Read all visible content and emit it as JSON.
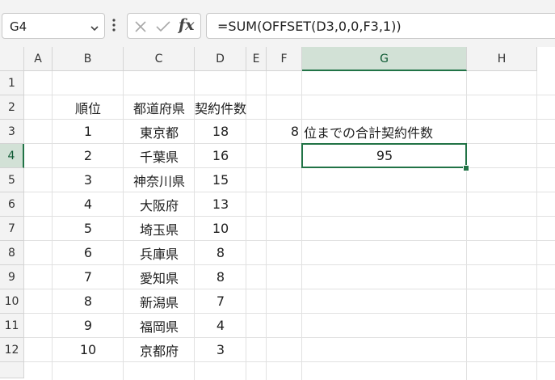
{
  "formula_bar": {
    "name_box": "G4",
    "formula": "=SUM(OFFSET(D3,0,0,F3,1))"
  },
  "columns": [
    "A",
    "B",
    "C",
    "D",
    "E",
    "F",
    "G",
    "H"
  ],
  "rows": [
    "1",
    "2",
    "3",
    "4",
    "5",
    "6",
    "7",
    "8",
    "9",
    "10",
    "11",
    "12"
  ],
  "selection": {
    "column": "G",
    "row": "4"
  },
  "table": {
    "headers": {
      "rank": "順位",
      "prefecture": "都道府県",
      "contracts": "契約件数"
    },
    "records": [
      {
        "rank": "1",
        "prefecture": "東京都",
        "contracts": "18"
      },
      {
        "rank": "2",
        "prefecture": "千葉県",
        "contracts": "16"
      },
      {
        "rank": "3",
        "prefecture": "神奈川県",
        "contracts": "15"
      },
      {
        "rank": "4",
        "prefecture": "大阪府",
        "contracts": "13"
      },
      {
        "rank": "5",
        "prefecture": "埼玉県",
        "contracts": "10"
      },
      {
        "rank": "6",
        "prefecture": "兵庫県",
        "contracts": "8"
      },
      {
        "rank": "7",
        "prefecture": "愛知県",
        "contracts": "8"
      },
      {
        "rank": "8",
        "prefecture": "新潟県",
        "contracts": "7"
      },
      {
        "rank": "9",
        "prefecture": "福岡県",
        "contracts": "4"
      },
      {
        "rank": "10",
        "prefecture": "京都府",
        "contracts": "3"
      }
    ]
  },
  "calc": {
    "f3_value": "8",
    "g3_label": "位までの合計契約件数",
    "g4_result": "95"
  },
  "colors": {
    "accent": "#217346",
    "header_bg": "#f3f3f3",
    "gridline": "#e1e1e1"
  }
}
